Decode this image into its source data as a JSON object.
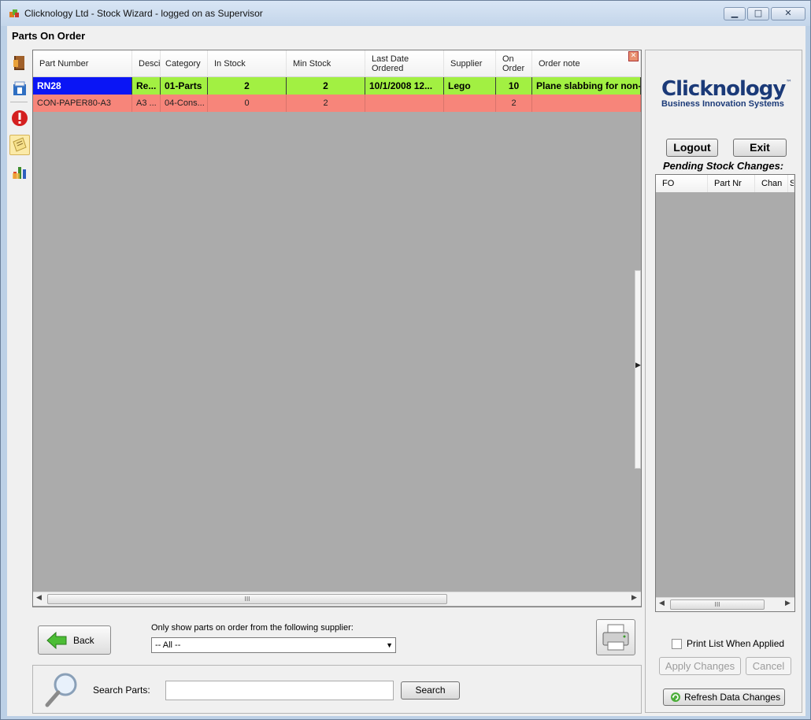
{
  "window": {
    "title": "Clicknology Ltd - Stock Wizard - logged on as Supervisor",
    "controls": {
      "minimize": "▁",
      "maximize": "□",
      "close": "✕"
    }
  },
  "page": {
    "title": "Parts On Order"
  },
  "toolbar": {
    "tools": [
      {
        "name": "parts-book-icon"
      },
      {
        "name": "stock-box-icon"
      },
      {
        "name": "alert-icon"
      },
      {
        "name": "order-notes-icon"
      },
      {
        "name": "reports-chart-icon"
      }
    ]
  },
  "grid": {
    "columns": [
      "Part Number",
      "Desci",
      "Category",
      "In Stock",
      "Min Stock",
      "Last Date Ordered",
      "Supplier",
      "On Order",
      "Order note"
    ],
    "columns_display": {
      "part_number": "Part Number",
      "description": "Desci",
      "category": "Category",
      "in_stock": "In Stock",
      "min_stock": "Min Stock",
      "last_date_line1": "Last Date",
      "last_date_line2": "Ordered",
      "supplier": "Supplier",
      "on_order_line1": "On",
      "on_order_line2": "Order",
      "order_note": "Order note"
    },
    "close_glyph": "✕",
    "rows": [
      {
        "part_number": "RN28",
        "description": "Re...",
        "category": "01-Parts",
        "in_stock": "2",
        "min_stock": "2",
        "last_date_ordered": "10/1/2008 12...",
        "supplier": "Lego",
        "on_order": "10",
        "order_note": "Plane slabbing for non-",
        "status": "selected"
      },
      {
        "part_number": "CON-PAPER80-A3",
        "description": "A3 ...",
        "category": "04-Cons...",
        "in_stock": "0",
        "min_stock": "2",
        "last_date_ordered": "",
        "supplier": "",
        "on_order": "2",
        "order_note": "",
        "status": "below-minimum"
      }
    ],
    "row_colors": {
      "selected": "#a2f042",
      "selected_key": "#0a15f5",
      "below_minimum": "#f7857a"
    },
    "scroll": {
      "left": "◀",
      "right": "▶",
      "grip": "III"
    }
  },
  "bottom": {
    "back_label": "Back",
    "supplier_filter_label": "Only show parts on order from the following supplier:",
    "supplier_filter_value": "-- All --",
    "dropdown_glyph": "▼"
  },
  "search": {
    "label": "Search Parts:",
    "value": "",
    "button_label": "Search"
  },
  "right_panel": {
    "logo_name": "Clicknology",
    "logo_tm": "™",
    "logo_tagline": "Business Innovation Systems",
    "logout_label": "Logout",
    "exit_label": "Exit",
    "pending_title": "Pending Stock Changes:",
    "pending_columns": {
      "c1": "FO",
      "c2": "Part Nr",
      "c3": "Chan",
      "c4": "S"
    },
    "print_list_label": "Print List When Applied",
    "print_list_checked": false,
    "apply_label": "Apply Changes",
    "cancel_label": "Cancel",
    "refresh_label": "Refresh Data Changes"
  },
  "colors": {
    "accent": "#1b3a78",
    "grid_bg": "#ababab"
  }
}
